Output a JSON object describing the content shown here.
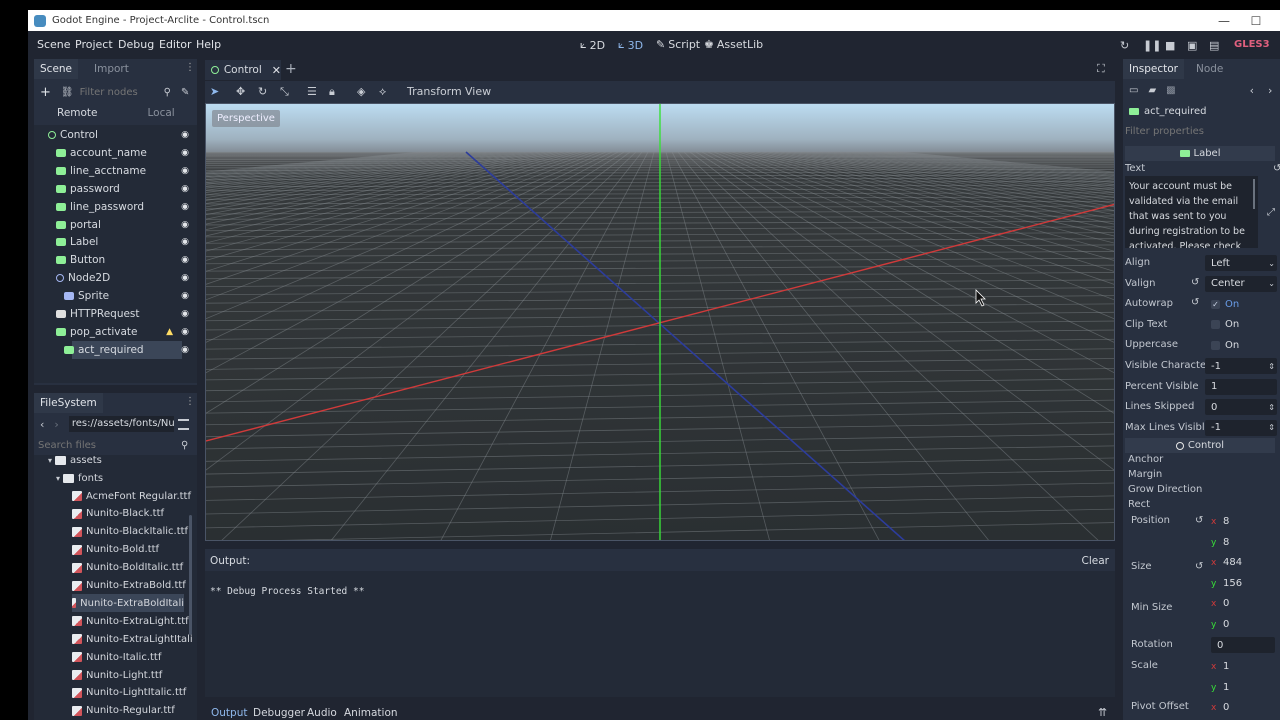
{
  "window": {
    "title": "Godot Engine - Project-Arclite - Control.tscn",
    "minimize_icon": "—",
    "maximize_icon": "☐"
  },
  "menubar": {
    "items": [
      "Scene",
      "Project",
      "Debug",
      "Editor",
      "Help"
    ],
    "workspaces": [
      {
        "label": "2D",
        "icon": "⟀"
      },
      {
        "label": "3D",
        "icon": "⟀"
      },
      {
        "label": "Script",
        "icon": "✎"
      },
      {
        "label": "AssetLib",
        "icon": "♚"
      }
    ],
    "renderer": "GLES3"
  },
  "scene_panel": {
    "tabs": [
      "Scene",
      "Import"
    ],
    "filter_placeholder": "Filter nodes",
    "remote": "Remote",
    "local": "Local",
    "nodes": [
      {
        "name": "Control",
        "depth": 0,
        "icon_color": "#8eef97",
        "ring": true
      },
      {
        "name": "account_name",
        "depth": 1,
        "icon_color": "#8eef97"
      },
      {
        "name": "line_acctname",
        "depth": 1,
        "icon_color": "#8eef97"
      },
      {
        "name": "password",
        "depth": 1,
        "icon_color": "#8eef97"
      },
      {
        "name": "line_password",
        "depth": 1,
        "icon_color": "#8eef97"
      },
      {
        "name": "portal",
        "depth": 1,
        "icon_color": "#8eef97"
      },
      {
        "name": "Label",
        "depth": 1,
        "icon_color": "#8eef97"
      },
      {
        "name": "Button",
        "depth": 1,
        "icon_color": "#8eef97"
      },
      {
        "name": "Node2D",
        "depth": 1,
        "icon_color": "#a5b7f3",
        "ring": true
      },
      {
        "name": "Sprite",
        "depth": 2,
        "icon_color": "#a5b7f3"
      },
      {
        "name": "HTTPRequest",
        "depth": 1,
        "icon_color": "#e0e0e0"
      },
      {
        "name": "pop_activate",
        "depth": 1,
        "icon_color": "#8eef97"
      },
      {
        "name": "act_required",
        "depth": 2,
        "icon_color": "#8eef97",
        "selected": true
      }
    ]
  },
  "filesystem": {
    "tab": "FileSystem",
    "path": "res://assets/fonts/Nuni",
    "search_placeholder": "Search files",
    "folders": [
      "assets",
      "fonts"
    ],
    "files": [
      "AcmeFont Regular.ttf",
      "Nunito-Black.ttf",
      "Nunito-BlackItalic.ttf",
      "Nunito-Bold.ttf",
      "Nunito-BoldItalic.ttf",
      "Nunito-ExtraBold.ttf",
      "Nunito-ExtraBoldItali",
      "Nunito-ExtraLight.ttf",
      "Nunito-ExtraLightItali",
      "Nunito-Italic.ttf",
      "Nunito-Light.ttf",
      "Nunito-LightItalic.ttf",
      "Nunito-Regular.ttf"
    ],
    "selected_index": 6
  },
  "editor": {
    "scene_tab": "Control",
    "add_tab": "+",
    "menus": [
      "Transform",
      "View"
    ],
    "perspective": "Perspective"
  },
  "output": {
    "label": "Output:",
    "clear": "Clear",
    "log": "** Debug Process Started **",
    "bottom_tabs": [
      "Output",
      "Debugger",
      "Audio",
      "Animation"
    ]
  },
  "inspector": {
    "tabs": [
      "Inspector",
      "Node"
    ],
    "node_name": "act_required",
    "filter_placeholder": "Filter properties",
    "section_label": "Label",
    "text_label": "Text",
    "text_value": "Your account must be validated via the email that was sent to you during registration to be activated. Please check",
    "props": [
      {
        "label": "Align",
        "value": "Left",
        "kind": "enum"
      },
      {
        "label": "Valign",
        "value": "Center",
        "kind": "enum",
        "revert": true
      },
      {
        "label": "Autowrap",
        "value": "On",
        "kind": "check",
        "checked": true,
        "revert": true
      },
      {
        "label": "Clip Text",
        "value": "On",
        "kind": "check",
        "checked": false
      },
      {
        "label": "Uppercase",
        "value": "On",
        "kind": "check",
        "checked": false
      },
      {
        "label": "Visible Character",
        "value": "-1",
        "kind": "spin"
      },
      {
        "label": "Percent Visible",
        "value": "1",
        "kind": "slider"
      },
      {
        "label": "Lines Skipped",
        "value": "0",
        "kind": "spin"
      },
      {
        "label": "Max Lines Visibl",
        "value": "-1",
        "kind": "spin"
      }
    ],
    "control_section": "Control",
    "groups": [
      "Anchor",
      "Margin",
      "Grow Direction",
      "Rect"
    ],
    "rect": [
      {
        "label": "Position",
        "x": "8",
        "y": "8",
        "revert": true
      },
      {
        "label": "Size",
        "x": "484",
        "y": "156",
        "revert": true
      },
      {
        "label": "Min Size",
        "x": "0",
        "y": "0"
      }
    ],
    "rotation": {
      "label": "Rotation",
      "value": "0"
    },
    "scale": {
      "label": "Scale",
      "x": "1",
      "y": "1"
    },
    "pivot": {
      "label": "Pivot Offset",
      "x": "0"
    }
  },
  "colors": {
    "accent": "#699ce8",
    "x_axis": "#d03a3a",
    "y_axis": "#38e038",
    "z_axis": "#2c3c9c",
    "warning": "#ffdd65"
  }
}
